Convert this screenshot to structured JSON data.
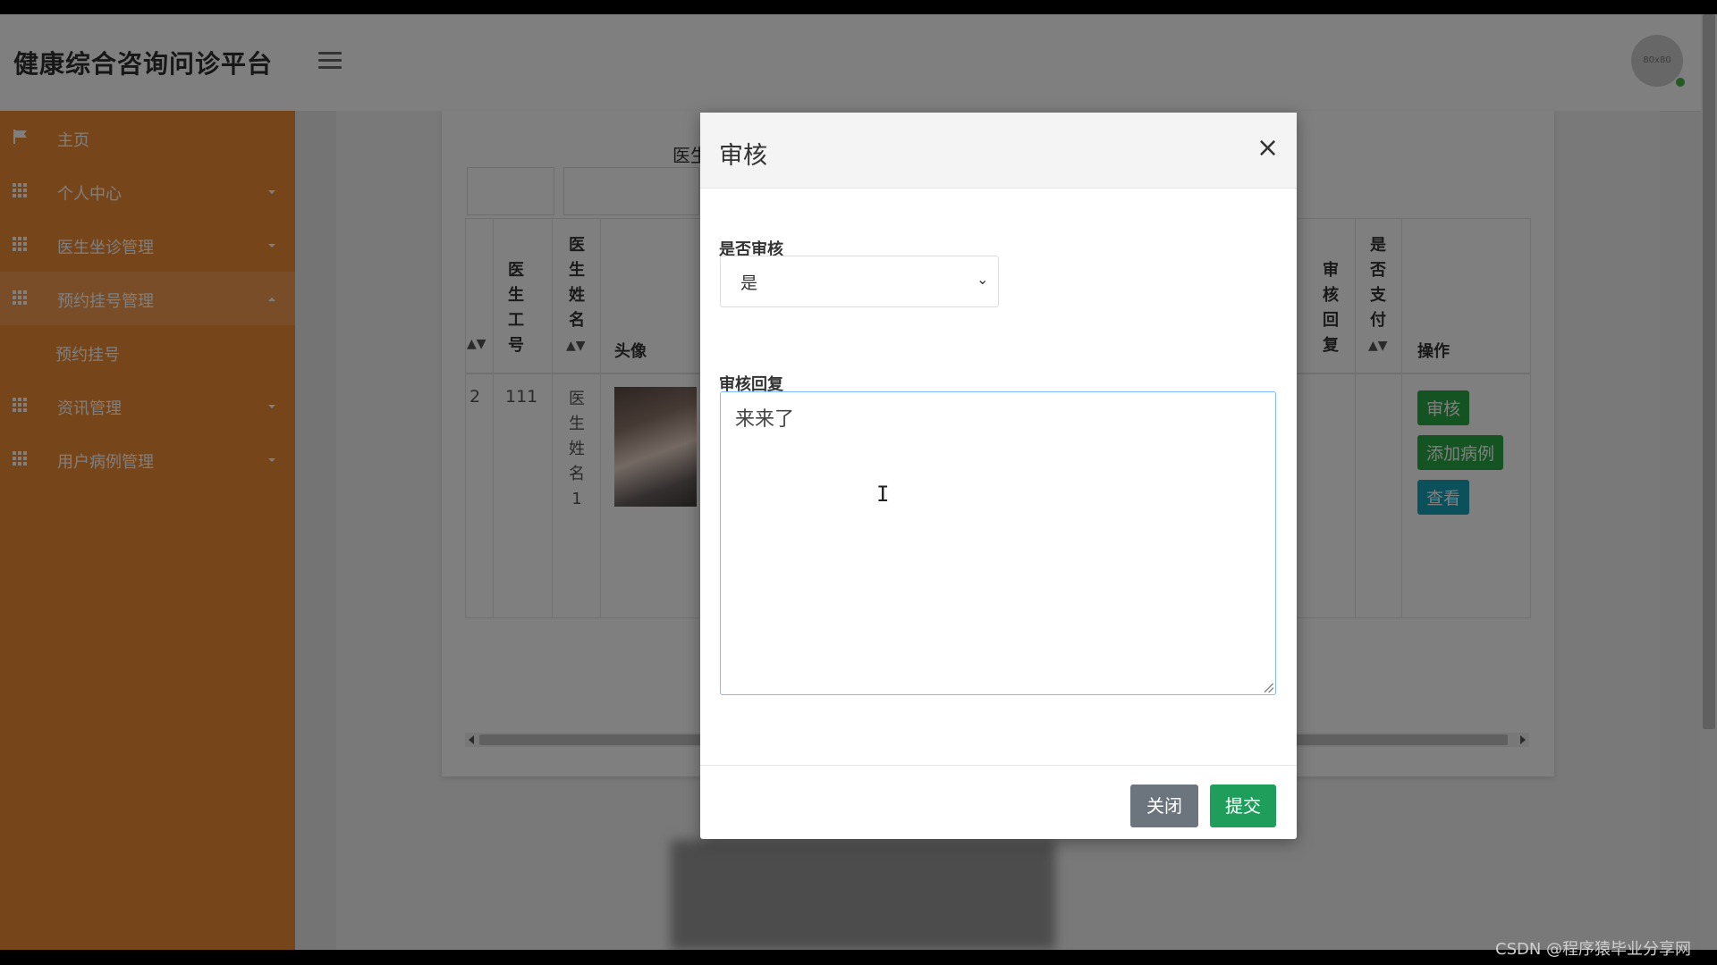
{
  "app": {
    "title": "健康综合咨询问诊平台",
    "avatar_text": "80x80"
  },
  "sidebar": {
    "items": [
      {
        "label": "主页",
        "icon": "flag-icon"
      },
      {
        "label": "个人中心",
        "icon": "grid-icon"
      },
      {
        "label": "医生坐诊管理",
        "icon": "grid-icon"
      },
      {
        "label": "预约挂号管理",
        "icon": "grid-icon",
        "expanded": true
      },
      {
        "label": "资讯管理",
        "icon": "grid-icon"
      },
      {
        "label": "用户病例管理",
        "icon": "grid-icon"
      }
    ],
    "sub_items": [
      {
        "label": "预约挂号"
      }
    ],
    "colors": {
      "bg": "#ee8a34",
      "active": "#f29b4e"
    }
  },
  "search": {
    "label": "医生姓名"
  },
  "table": {
    "headers": {
      "doctor_no": "医生工号",
      "doctor_name": "医生姓名",
      "avatar": "头像",
      "audit_reply": "审核回复",
      "paid": "是否支付",
      "actions": "操作"
    },
    "rows": [
      {
        "index": "2",
        "doctor_no": "111",
        "doctor_name": "医生姓名1"
      }
    ],
    "row_buttons": {
      "audit": "审核",
      "add_case": "添加病例",
      "view": "查看"
    }
  },
  "modal": {
    "title": "审核",
    "close_symbol": "×",
    "audit_label": "是否审核",
    "audit_value": "是",
    "reply_label": "审核回复",
    "reply_value": "来来了",
    "close_button": "关闭",
    "submit_button": "提交"
  },
  "watermark": "CSDN @程序猿毕业分享网",
  "colors": {
    "green": "#28a745",
    "teal": "#17a2b8",
    "gray": "#6c757d",
    "submit": "#1e9e5a"
  }
}
